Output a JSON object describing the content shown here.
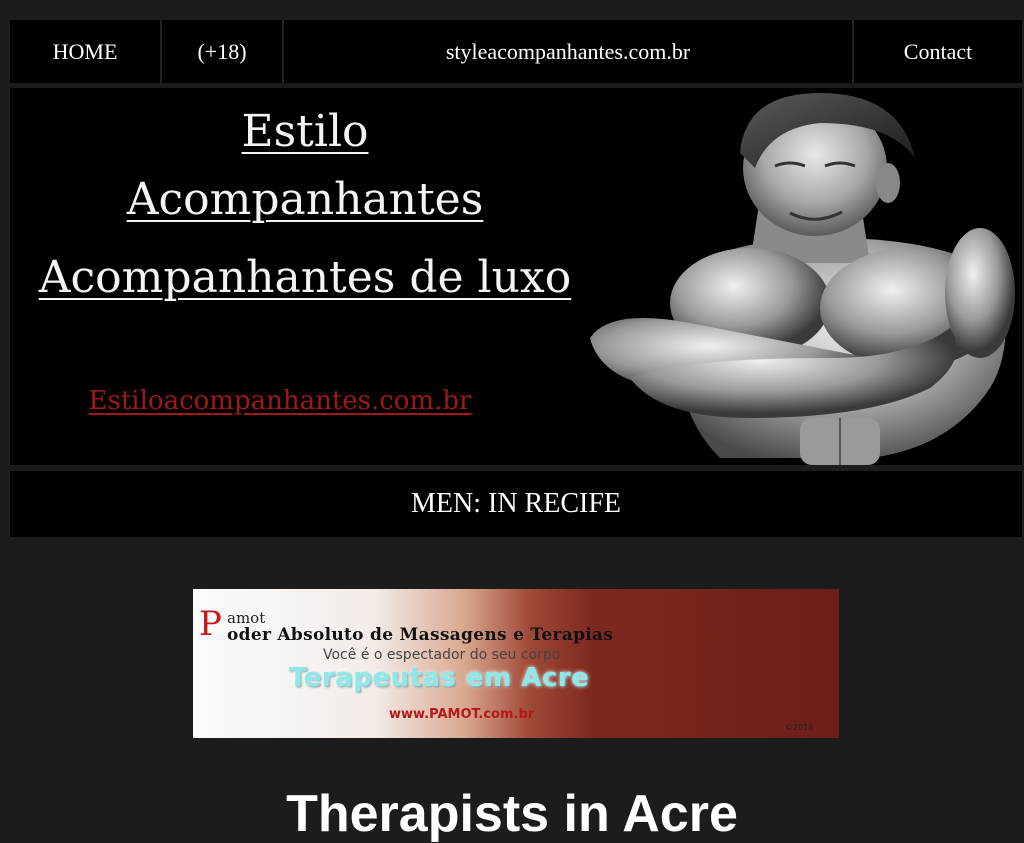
{
  "nav": {
    "items": [
      {
        "label": "HOME"
      },
      {
        "label": "(+18)"
      },
      {
        "label": "styleacompanhantes.com.br"
      },
      {
        "label": "Contact"
      }
    ]
  },
  "banner": {
    "line1": "Estilo",
    "line2": "Acompanhantes",
    "line3": "Acompanhantes de luxo",
    "link": "Estiloacompanhantes.com.br",
    "image_icon": "illustrated-man-arms-crossed"
  },
  "section": {
    "title": "MEN: IN RECIFE"
  },
  "ad": {
    "initial": "P",
    "brand_line1": "amot",
    "brand_line2": "oder Absoluto de Massagens e Terapias",
    "subtitle": "Você é o espectador do seu corpo",
    "headline": "Terapeutas em Acre",
    "url": "www.PAMOT.com.br",
    "year": "©2016",
    "colors": {
      "initial": "#c41a1a",
      "headline": "#8ee8e8",
      "url": "#b41818"
    }
  },
  "bottom": {
    "heading": "Therapists in Acre"
  },
  "colors": {
    "page_bg": "#1c1c1c",
    "panel_bg": "#000000",
    "link_red": "#a01818"
  }
}
